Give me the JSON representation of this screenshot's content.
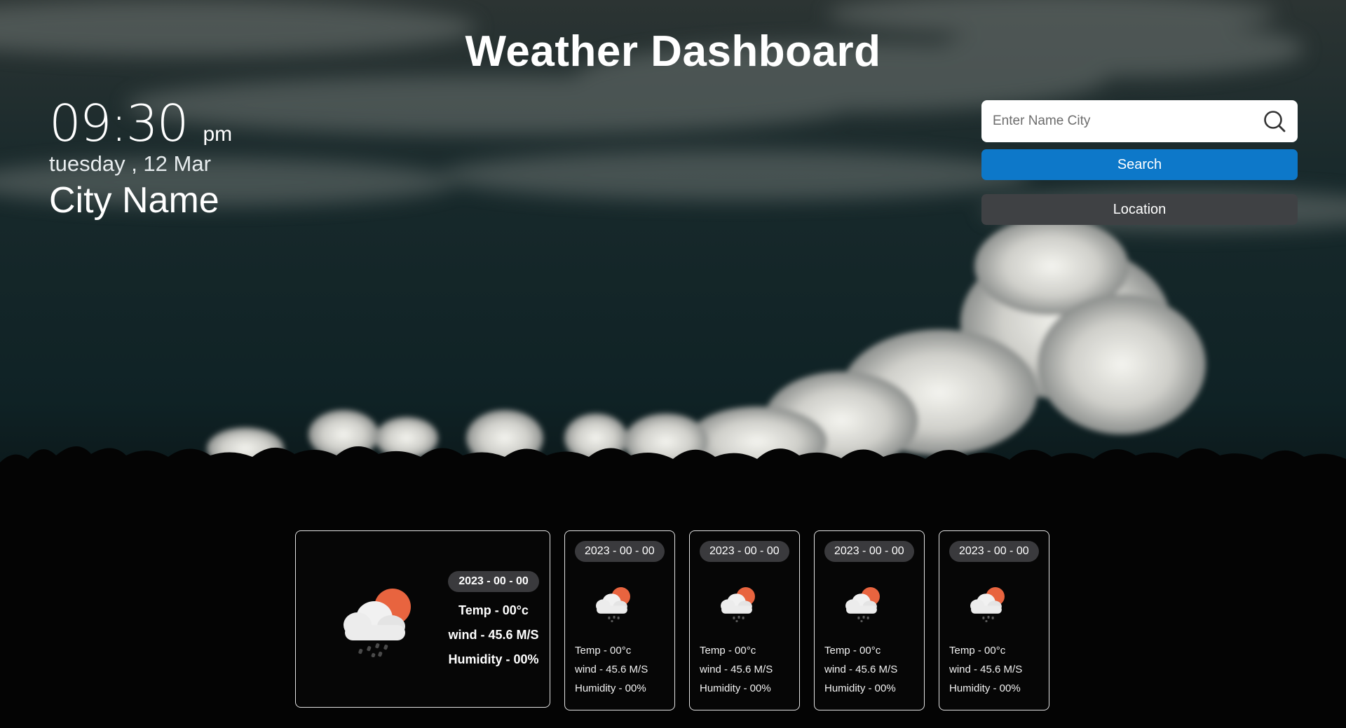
{
  "header": {
    "title": "Weather Dashboard"
  },
  "clock": {
    "time": "09:30",
    "ampm": "pm",
    "date": "tuesday , 12 Mar",
    "city": "City Name"
  },
  "search": {
    "placeholder": "Enter Name City",
    "search_label": "Search",
    "location_label": "Location"
  },
  "colors": {
    "search_button": "#0d78c9",
    "location_button": "#3f4144",
    "sun": "#e8643f"
  },
  "today": {
    "date": "2023 - 00 - 00",
    "temp": "Temp - 00°c",
    "wind": "wind - 45.6 M/S",
    "humidity": "Humidity - 00%",
    "icon": "rain-cloud-sun-icon"
  },
  "forecast": [
    {
      "date": "2023 - 00 - 00",
      "temp": "Temp - 00°c",
      "wind": "wind - 45.6 M/S",
      "humidity": "Humidity - 00%",
      "icon": "rain-cloud-sun-icon"
    },
    {
      "date": "2023 - 00 - 00",
      "temp": "Temp - 00°c",
      "wind": "wind - 45.6 M/S",
      "humidity": "Humidity - 00%",
      "icon": "rain-cloud-sun-icon"
    },
    {
      "date": "2023 - 00 - 00",
      "temp": "Temp - 00°c",
      "wind": "wind - 45.6 M/S",
      "humidity": "Humidity - 00%",
      "icon": "rain-cloud-sun-icon"
    },
    {
      "date": "2023 - 00 - 00",
      "temp": "Temp - 00°c",
      "wind": "wind - 45.6 M/S",
      "humidity": "Humidity - 00%",
      "icon": "rain-cloud-sun-icon"
    }
  ]
}
